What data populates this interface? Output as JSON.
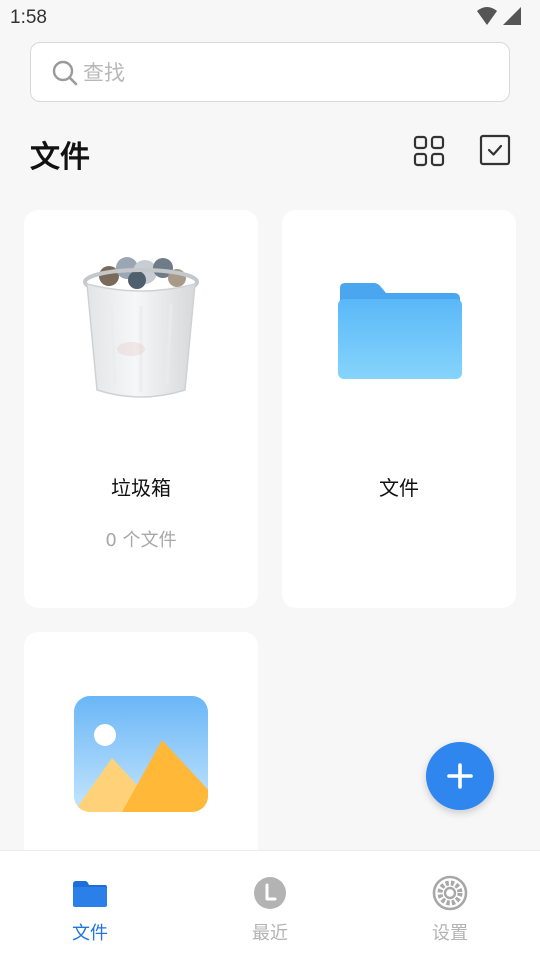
{
  "status_bar": {
    "time": "1:58"
  },
  "search": {
    "placeholder": "查找",
    "value": ""
  },
  "header": {
    "title": "文件"
  },
  "cards": [
    {
      "label": "垃圾箱",
      "sublabel": "0 个文件",
      "icon": "trash-bin-icon"
    },
    {
      "label": "文件",
      "icon": "folder-icon"
    },
    {
      "label": "",
      "icon": "image-gallery-icon"
    }
  ],
  "fab": {
    "icon": "plus-icon"
  },
  "bottom_nav": {
    "items": [
      {
        "label": "文件",
        "icon": "folder-icon",
        "active": true
      },
      {
        "label": "最近",
        "icon": "clock-icon",
        "active": false
      },
      {
        "label": "设置",
        "icon": "gear-icon",
        "active": false
      }
    ]
  },
  "colors": {
    "accent": "#2e86ee",
    "nav_active": "#1f74e0",
    "nav_inactive": "#b3b3b3",
    "background": "#f7f7f7"
  }
}
